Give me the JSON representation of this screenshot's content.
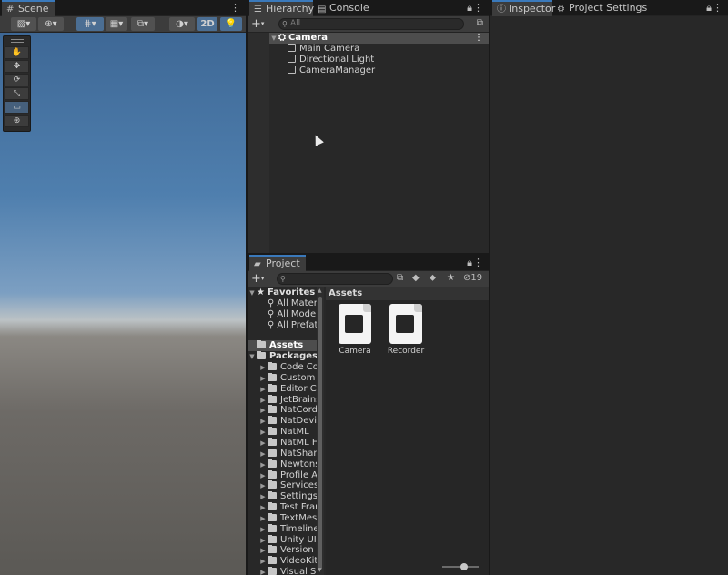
{
  "scene": {
    "tab_label": "Scene",
    "toolbar": {
      "mode_2d": "2D"
    }
  },
  "hierarchy": {
    "tabs": [
      "Hierarchy",
      "Console"
    ],
    "search_placeholder": "All",
    "root": "Camera",
    "children": [
      "Main Camera",
      "Directional Light",
      "CameraManager"
    ]
  },
  "inspector": {
    "tabs": [
      "Inspector",
      "Project Settings"
    ]
  },
  "project": {
    "tab_label": "Project",
    "hidden_count": "19",
    "favorites_label": "Favorites",
    "favorites": [
      "All Materi",
      "All Model",
      "All Prefat"
    ],
    "assets_label": "Assets",
    "packages_label": "Packages",
    "packages": [
      "Code Cov",
      "Custom N",
      "Editor Co",
      "JetBrains",
      "NatCorde",
      "NatDevic",
      "NatML",
      "NatML Hu",
      "NatShare",
      "Newtonsc",
      "Profile An",
      "Services",
      "Settings N",
      "Test Fram",
      "TextMesh",
      "Timeline",
      "Unity UI",
      "Version C",
      "VideoKit",
      "Visual Sc"
    ],
    "breadcrumb": "Assets",
    "files": [
      "Camera",
      "Recorder"
    ]
  },
  "colors": {
    "accent": "#3a79bb",
    "panel_bg": "#282828",
    "tab_bg": "#191919"
  }
}
